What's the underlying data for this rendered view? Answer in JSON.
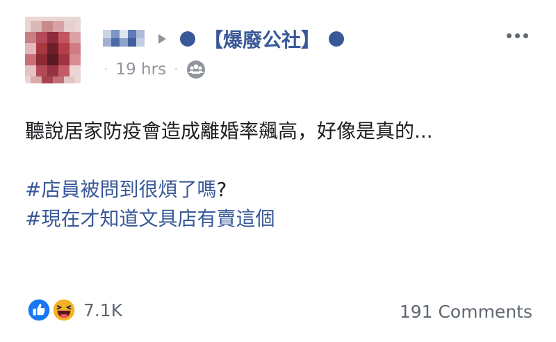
{
  "post": {
    "author_name_blurred": true,
    "group_name": "【爆廢公社】",
    "timestamp": "19 hrs",
    "audience_icon": "friends-icon",
    "more_icon": "more-horizontal-icon",
    "text": "聽說居家防疫會造成離婚率飆高，好像是真的...",
    "hashtags": [
      {
        "tag": "#店員被問到很煩了嗎",
        "suffix": "?"
      },
      {
        "tag": "#現在才知道文具店有賣這個",
        "suffix": ""
      }
    ]
  },
  "footer": {
    "reaction_icons": [
      "like-icon",
      "haha-icon"
    ],
    "reaction_count": "7.1K",
    "comments_label": "191 Comments"
  },
  "colors": {
    "link": "#385898",
    "text": "#1c1e21",
    "muted": "#90949c",
    "secondary": "#606770",
    "like_blue": "#1877f2",
    "haha_yellow": "#f7b125"
  }
}
